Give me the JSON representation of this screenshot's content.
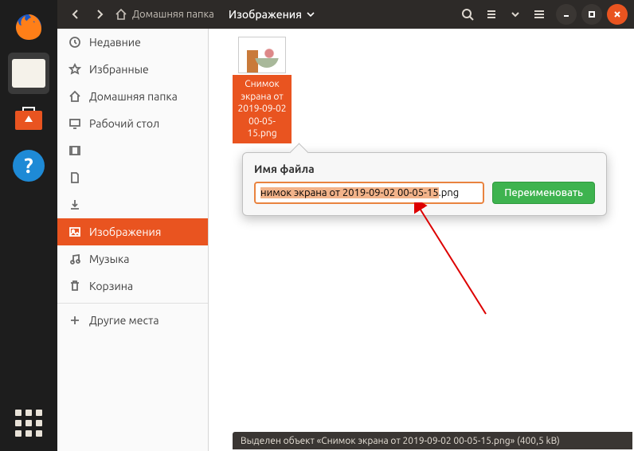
{
  "titlebar": {
    "crumb_home": "Домашняя папка",
    "location": "Изображения"
  },
  "sidebar": {
    "items": [
      {
        "id": "recent",
        "label": "Недавние"
      },
      {
        "id": "starred",
        "label": "Избранные"
      },
      {
        "id": "home",
        "label": "Домашняя папка"
      },
      {
        "id": "desktop",
        "label": "Рабочий стол"
      },
      {
        "id": "videos",
        "label": ""
      },
      {
        "id": "documents",
        "label": ""
      },
      {
        "id": "downloads",
        "label": ""
      },
      {
        "id": "pictures",
        "label": "Изображения"
      },
      {
        "id": "music",
        "label": "Музыка"
      },
      {
        "id": "trash",
        "label": "Корзина"
      },
      {
        "id": "other",
        "label": "Другие места"
      }
    ]
  },
  "file": {
    "label": "Снимок экрана от 2019-09-02 00-05-15.png"
  },
  "popover": {
    "title": "Имя файла",
    "input_selected": "нимок экрана от 2019-09-02 00-05-15",
    "input_ext": ".png",
    "rename_btn": "Переименовать"
  },
  "statusbar": {
    "text": "Выделен объект «Снимок экрана от 2019-09-02 00-05-15.png»  (400,5 kB)"
  }
}
